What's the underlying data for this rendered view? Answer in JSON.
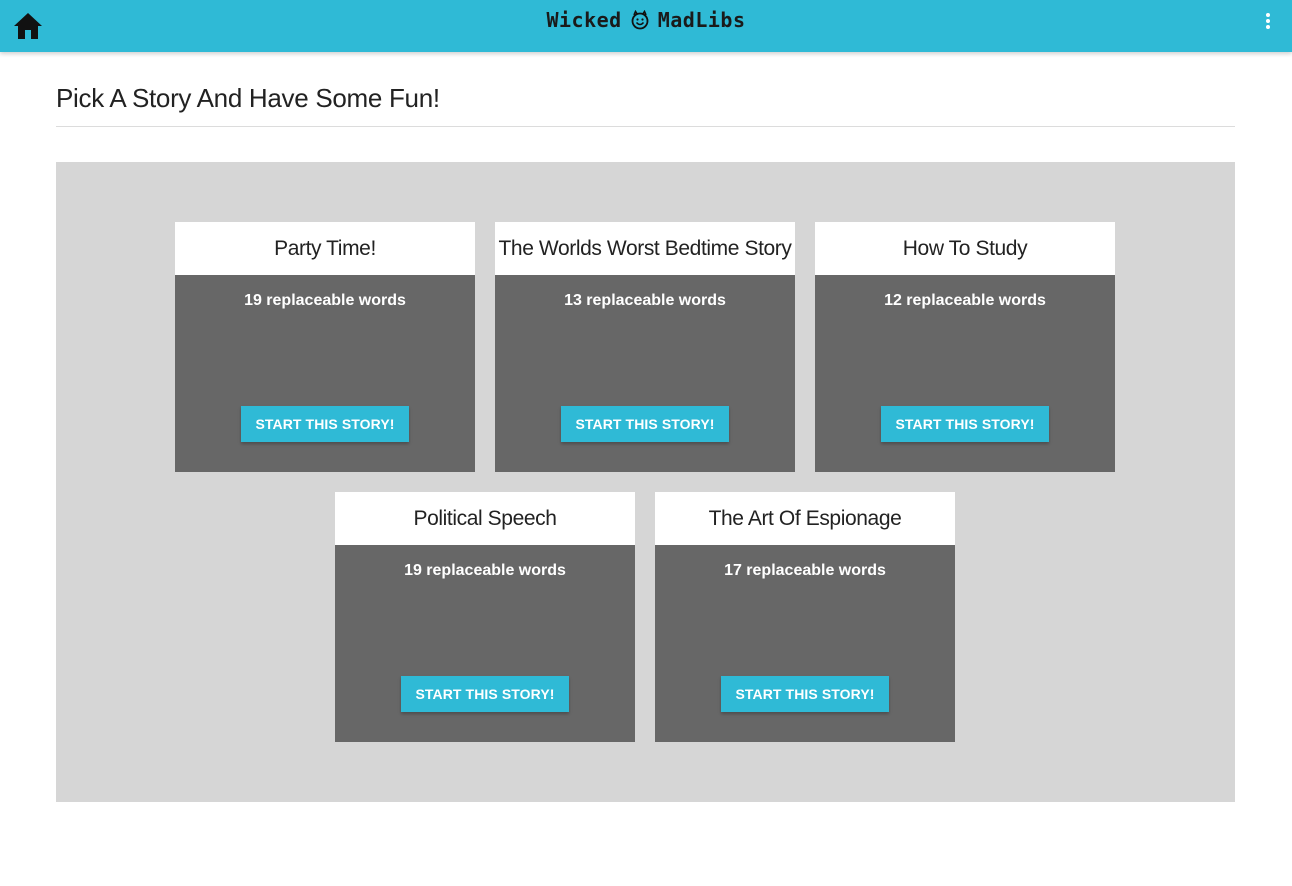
{
  "app": {
    "brand_left": "Wicked",
    "brand_right": "MadLibs",
    "accent_color": "#2fbad6",
    "home_icon": "home-icon",
    "menu_icon": "more-vertical-icon",
    "logo_icon": "devil-face-icon"
  },
  "page": {
    "title": "Pick A Story And Have Some Fun!"
  },
  "stories": [
    {
      "title": "Party Time!",
      "count_text": "19 replaceable words",
      "button_label": "START THIS STORY!"
    },
    {
      "title": "The Worlds Worst Bedtime Story",
      "count_text": "13 replaceable words",
      "button_label": "START THIS STORY!"
    },
    {
      "title": "How To Study",
      "count_text": "12 replaceable words",
      "button_label": "START THIS STORY!"
    },
    {
      "title": "Political Speech",
      "count_text": "19 replaceable words",
      "button_label": "START THIS STORY!"
    },
    {
      "title": "The Art Of Espionage",
      "count_text": "17 replaceable words",
      "button_label": "START THIS STORY!"
    }
  ]
}
